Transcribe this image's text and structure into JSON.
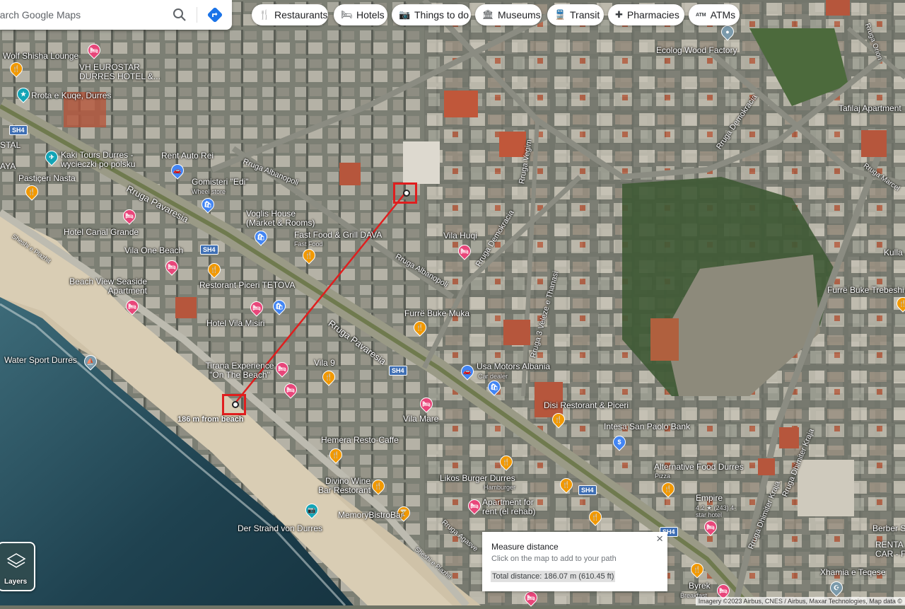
{
  "search": {
    "placeholder": "Search Google Maps",
    "value": "earch Google Maps"
  },
  "chips": [
    {
      "icon": "fork-knife-icon",
      "glyph": "🍴",
      "label": "Restaurants"
    },
    {
      "icon": "bed-icon",
      "glyph": "🛏",
      "label": "Hotels"
    },
    {
      "icon": "camera-icon",
      "glyph": "📷",
      "label": "Things to do"
    },
    {
      "icon": "museum-icon",
      "glyph": "🏛",
      "label": "Museums"
    },
    {
      "icon": "train-icon",
      "glyph": "🚆",
      "label": "Transit"
    },
    {
      "icon": "pharmacy-icon",
      "glyph": "✚",
      "label": "Pharmacies"
    },
    {
      "icon": "atm-icon",
      "glyph": "ATM",
      "label": "ATMs"
    }
  ],
  "places": [
    {
      "name": "Wolf Shisha Lounge",
      "type": "food"
    },
    {
      "name": "VH EUROSTAR DURRES HOTEL &...",
      "type": "hotel"
    },
    {
      "name": "Rrota e Kuqe, Durres",
      "type": "teal"
    },
    {
      "name": "Kaki Tours Durres - wycieczki po polsku",
      "type": "teal"
    },
    {
      "name": "Rent Auto Rei",
      "type": "blue"
    },
    {
      "name": "Pastiçeri Nasta",
      "type": "food"
    },
    {
      "name": "Gomisteri \"Edi\"",
      "sub": "Wheel store",
      "type": "shop"
    },
    {
      "name": "Voglis House (Market & Rooms)",
      "type": "shop"
    },
    {
      "name": "Fast Food & Grill DAVA",
      "sub": "Fast Food",
      "type": "food"
    },
    {
      "name": "Hotel Canal Grande",
      "type": "hotel"
    },
    {
      "name": "Vila One Beach",
      "type": "hotel"
    },
    {
      "name": "Beach View Seaside Apartment",
      "type": "hotel"
    },
    {
      "name": "Restorant Piceri TETOVA",
      "type": "food"
    },
    {
      "name": "Hotel Vila Misiri",
      "type": "hotel"
    },
    {
      "name": "Water Sport Durres",
      "type": "gray"
    },
    {
      "name": "Tirana Experience \"On The Beach\"",
      "type": "hotel"
    },
    {
      "name": "Vila 9",
      "type": "food"
    },
    {
      "name": "Vila Huqi",
      "type": "hotel"
    },
    {
      "name": "Furrë Buke Muka",
      "type": "food"
    },
    {
      "name": "Usa Motors Albania",
      "sub": "Car dealer",
      "type": "shop"
    },
    {
      "name": "Disi Restorant & Piceri",
      "type": "food"
    },
    {
      "name": "Vila Mare",
      "type": "hotel"
    },
    {
      "name": "Intesa San Paolo Bank",
      "type": "blue"
    },
    {
      "name": "Hemera Resto-Caffe",
      "type": "food"
    },
    {
      "name": "Alternative Food Durres",
      "sub": "Pizza",
      "type": "food"
    },
    {
      "name": "Divino Wine Bar Restorant",
      "type": "food"
    },
    {
      "name": "Likos Burger Durres",
      "sub": "Hamburger",
      "type": "food"
    },
    {
      "name": "Apartment for rent (el rehab)",
      "type": "hotel"
    },
    {
      "name": "Empire",
      "sub": "4.2 ★ (243) 4-star hotel",
      "type": "hotel"
    },
    {
      "name": "MemoryBistroBar",
      "type": "food"
    },
    {
      "name": "Der Strand von Durres",
      "type": "none"
    },
    {
      "name": "Ecolog Wood Factory",
      "type": "gray"
    },
    {
      "name": "Tafilaj Apartment",
      "type": "none"
    },
    {
      "name": "Furrë Buke Trebeshi",
      "type": "food"
    },
    {
      "name": "Berber S",
      "type": "none"
    },
    {
      "name": "RENTA CAR - F",
      "type": "none"
    },
    {
      "name": "Xhamia e Teqese",
      "type": "gray"
    },
    {
      "name": "Byrek",
      "sub": "Breakfast",
      "type": "food"
    },
    {
      "name": "Kulla",
      "type": "none"
    },
    {
      "name": "STAL",
      "type": "none"
    },
    {
      "name": "AYA",
      "type": "none"
    }
  ],
  "roads": [
    {
      "name": "Rruga Pavaresia"
    },
    {
      "name": "Rruga Pavaresia"
    },
    {
      "name": "Rruga Albanopoli"
    },
    {
      "name": "Rruga Albanopoli"
    },
    {
      "name": "Rruga Demokracia"
    },
    {
      "name": "Rruga Demokracia"
    },
    {
      "name": "Rruga Demokracia"
    },
    {
      "name": "Rruga Vegim"
    },
    {
      "name": "Rruga 3 Veleze e Thanasi"
    },
    {
      "name": "Rruga Dhimiter Kraja"
    },
    {
      "name": "Rruga Dhimiter Kraja"
    },
    {
      "name": "Rruga Orion"
    },
    {
      "name": "Rruga Marcel"
    },
    {
      "name": "Sheshi e Plazhit"
    },
    {
      "name": "Rruga Agasve"
    },
    {
      "name": "Sheshi e Plazhit"
    }
  ],
  "shields": [
    "SH4",
    "SH4",
    "SH4",
    "SH4",
    "SH4"
  ],
  "measure": {
    "title": "Measure distance",
    "hint": "Click on the map to add to your path",
    "total": "Total distance: 186.07 m (610.45 ft)",
    "on_map": "186 m from beach",
    "distance_m": 186.07,
    "distance_ft": 610.45
  },
  "layers": {
    "label": "Layers"
  },
  "attribution": "Imagery ©2023 Airbus, CNES / Airbus, Maxar Technologies, Map data ©",
  "colors": {
    "path": "#e01e1e",
    "food": "#f29900",
    "hotel": "#e8467a",
    "shop": "#4285f4",
    "directions": "#1a73e8"
  }
}
